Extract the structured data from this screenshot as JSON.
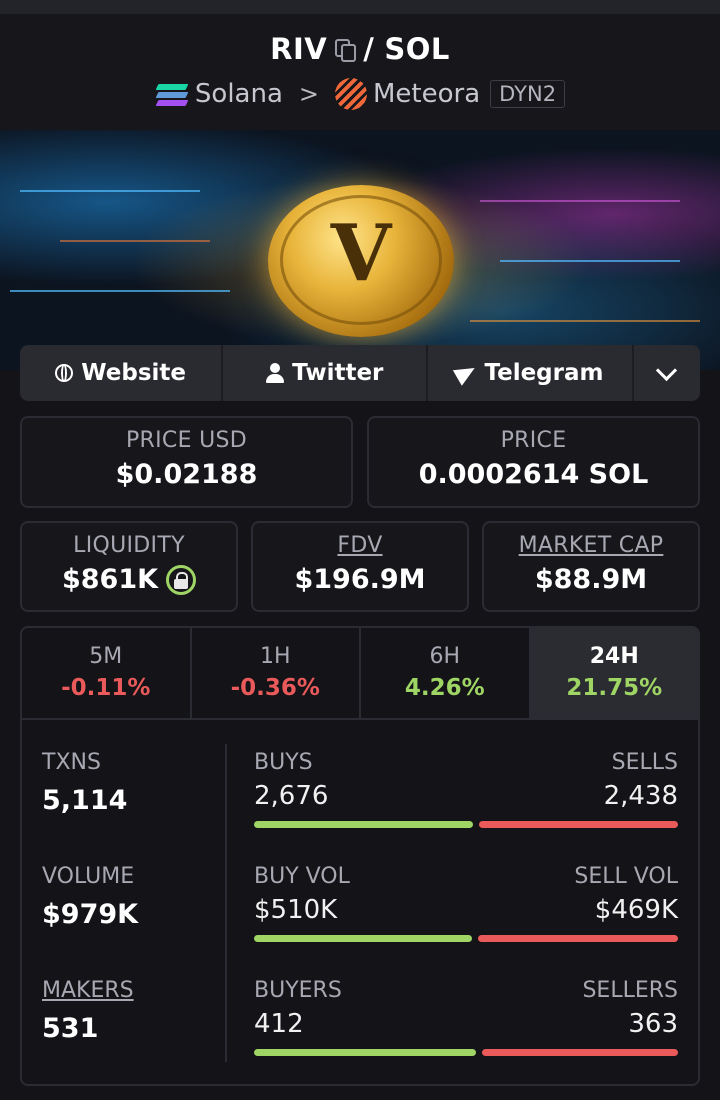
{
  "header": {
    "base_symbol": "RIV",
    "separator": "/",
    "quote_symbol": "SOL",
    "chain": "Solana",
    "chevron": ">",
    "dex": "Meteora",
    "pool_badge": "DYN2",
    "icons": [
      "copy-icon",
      "solana-icon",
      "meteora-icon"
    ]
  },
  "links": {
    "website": "Website",
    "twitter": "Twitter",
    "telegram": "Telegram",
    "icons": [
      "globe-icon",
      "user-icon",
      "telegram-icon",
      "chevron-down-icon"
    ]
  },
  "price": {
    "usd_label": "PRICE USD",
    "usd_value": "$0.02188",
    "native_label": "PRICE",
    "native_value": "0.0002614 SOL"
  },
  "metrics": {
    "liquidity_label": "LIQUIDITY",
    "liquidity_value": "$861K",
    "fdv_label": "FDV",
    "fdv_value": "$196.9M",
    "mcap_label": "MARKET CAP",
    "mcap_value": "$88.9M"
  },
  "timeframes": [
    {
      "label": "5M",
      "change": "-0.11%"
    },
    {
      "label": "1H",
      "change": "-0.36%"
    },
    {
      "label": "6H",
      "change": "4.26%"
    },
    {
      "label": "24H",
      "change": "21.75%"
    }
  ],
  "active_timeframe": "24H",
  "stats": {
    "txns_label": "TXNS",
    "txns_value": "5,114",
    "buys_label": "BUYS",
    "buys_value": "2,676",
    "sells_label": "SELLS",
    "sells_value": "2,438",
    "volume_label": "VOLUME",
    "volume_value": "$979K",
    "buy_vol_label": "BUY VOL",
    "buy_vol_value": "$510K",
    "sell_vol_label": "SELL VOL",
    "sell_vol_value": "$469K",
    "makers_label": "MAKERS",
    "makers_value": "531",
    "buyers_label": "BUYERS",
    "buyers_value": "412",
    "sellers_label": "SELLERS",
    "sellers_value": "363"
  },
  "colors": {
    "positive": "#9fd564",
    "negative": "#ea5a5a",
    "background": "#131318"
  }
}
